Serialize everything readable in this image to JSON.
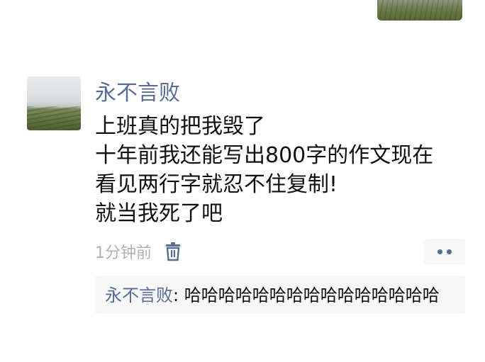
{
  "post": {
    "author": "永不言败",
    "lines": [
      "上班真的把我毁了",
      "十年前我还能写出800字的作文现在",
      "看见两行字就忍不住复制!",
      "就当我死了吧"
    ],
    "time": "1分钟前"
  },
  "comments": [
    {
      "author": "永不言败",
      "separator": ": ",
      "text": "哈哈哈哈哈哈哈哈哈哈哈哈哈哈哈"
    }
  ],
  "colors": {
    "link": "#576b95",
    "meta": "#b2b2b2",
    "panel": "#f7f7f7"
  },
  "icons": {
    "delete": "trash-icon",
    "more": "more-dots-icon"
  }
}
